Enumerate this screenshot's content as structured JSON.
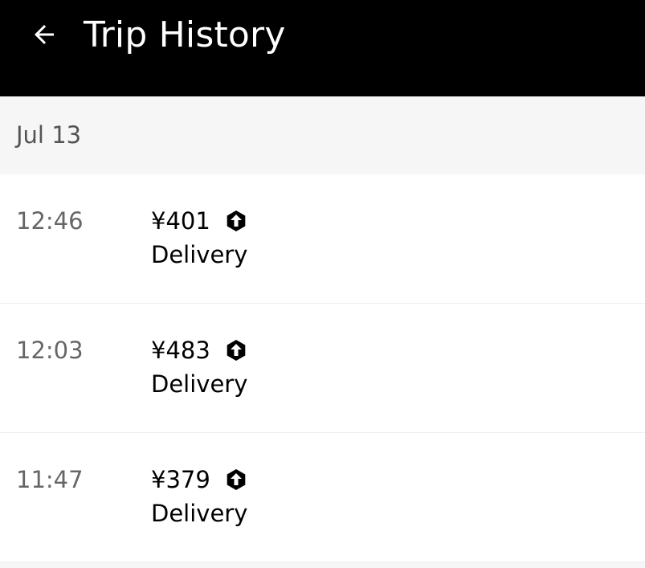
{
  "header": {
    "title": "Trip History",
    "back_icon": "arrow-left-icon"
  },
  "date_group": {
    "label": "Jul 13"
  },
  "trips": [
    {
      "time": "12:46",
      "fare": "¥401",
      "service": "Delivery",
      "icon": "upload-hexagon-icon"
    },
    {
      "time": "12:03",
      "fare": "¥483",
      "service": "Delivery",
      "icon": "upload-hexagon-icon"
    },
    {
      "time": "11:47",
      "fare": "¥379",
      "service": "Delivery",
      "icon": "upload-hexagon-icon"
    }
  ],
  "colors": {
    "header_bg": "#000000",
    "header_text": "#ffffff",
    "section_bg": "#f6f6f6",
    "muted_text": "#666666",
    "primary_text": "#000000"
  }
}
